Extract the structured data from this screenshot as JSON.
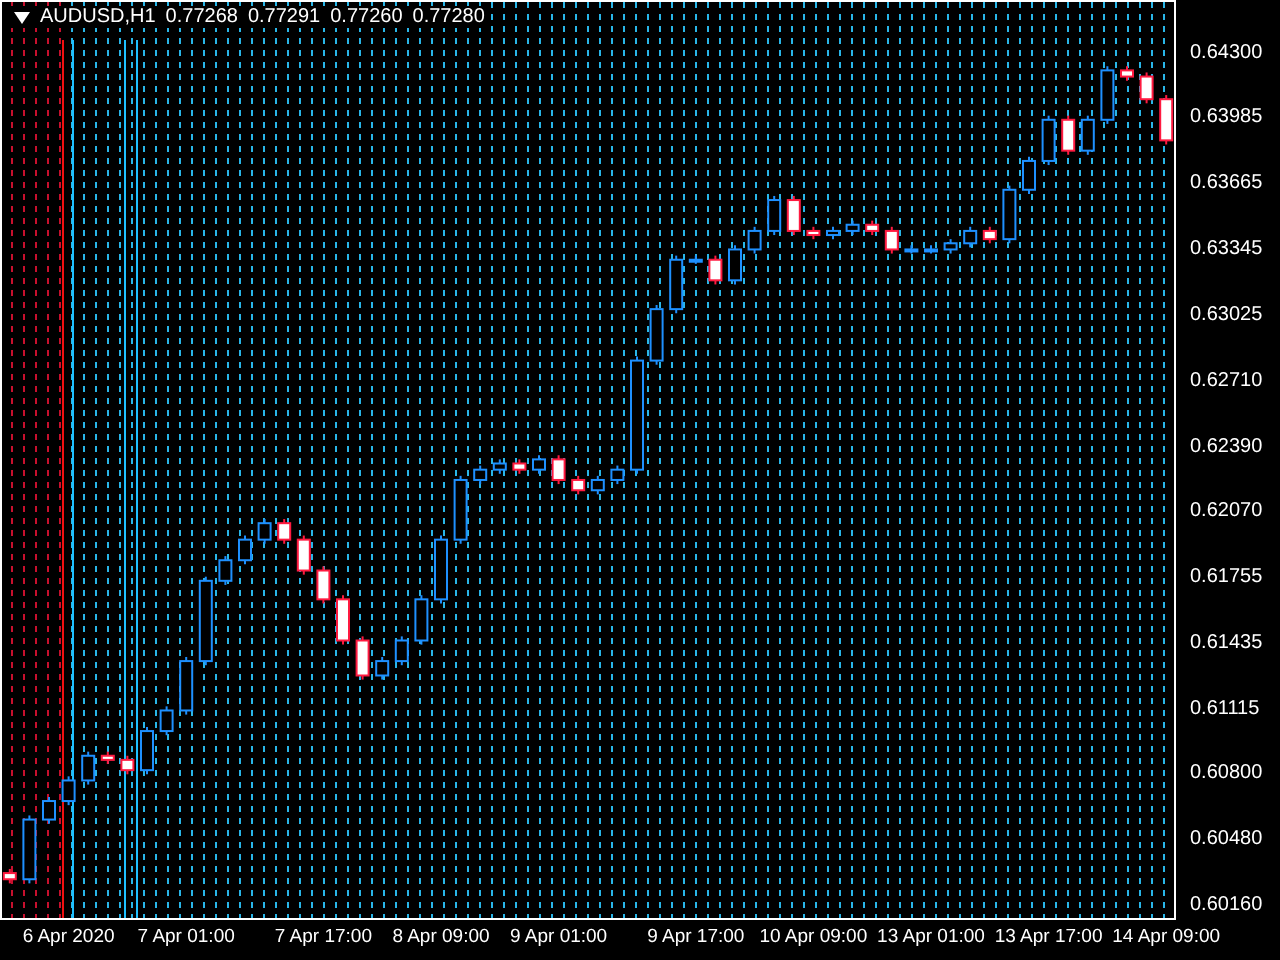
{
  "header": {
    "symbol": "AUDUSD,H1",
    "quotes": [
      "0.77268",
      "0.77291",
      "0.77260",
      "0.77280"
    ]
  },
  "chart_data": {
    "type": "candlestick",
    "ylim": [
      0.60092,
      0.64562
    ],
    "grid": true,
    "categories": [
      null,
      null,
      null,
      "6 Apr 2020",
      null,
      null,
      null,
      null,
      null,
      "7 Apr 01:00",
      null,
      null,
      null,
      null,
      null,
      null,
      "7 Apr 17:00",
      null,
      null,
      null,
      null,
      null,
      "8 Apr 09:00",
      null,
      null,
      null,
      null,
      null,
      "9 Apr 01:00",
      null,
      null,
      null,
      null,
      null,
      null,
      "9 Apr 17:00",
      null,
      null,
      null,
      null,
      null,
      "10 Apr 09:00",
      null,
      null,
      null,
      null,
      null,
      "13 Apr 01:00",
      null,
      null,
      null,
      null,
      null,
      "13 Apr 17:00",
      null,
      null,
      null,
      null,
      null,
      "14 Apr 09:00"
    ],
    "yticks": [
      {
        "value": 0.643,
        "label": "0.64300"
      },
      {
        "value": 0.63985,
        "label": "0.63985"
      },
      {
        "value": 0.63665,
        "label": "0.63665"
      },
      {
        "value": 0.63345,
        "label": "0.63345"
      },
      {
        "value": 0.63025,
        "label": "0.63025"
      },
      {
        "value": 0.6271,
        "label": "0.62710"
      },
      {
        "value": 0.6239,
        "label": "0.62390"
      },
      {
        "value": 0.6207,
        "label": "0.62070"
      },
      {
        "value": 0.61755,
        "label": "0.61755"
      },
      {
        "value": 0.61435,
        "label": "0.61435"
      },
      {
        "value": 0.61115,
        "label": "0.61115"
      },
      {
        "value": 0.608,
        "label": "0.60800"
      },
      {
        "value": 0.6048,
        "label": "0.60480"
      },
      {
        "value": 0.6016,
        "label": "0.60160"
      }
    ],
    "ohlc": [
      [
        0.6032,
        0.6034,
        0.6027,
        0.6029
      ],
      [
        0.6029,
        0.606,
        0.6027,
        0.6058
      ],
      [
        0.6058,
        0.6069,
        0.6056,
        0.6067
      ],
      [
        0.6067,
        0.6079,
        0.6065,
        0.6077
      ],
      [
        0.6077,
        0.6091,
        0.6075,
        0.6089
      ],
      [
        0.6089,
        0.6091,
        0.6085,
        0.6087
      ],
      [
        0.6087,
        0.6089,
        0.608,
        0.6082
      ],
      [
        0.6082,
        0.6103,
        0.608,
        0.6101
      ],
      [
        0.6101,
        0.6113,
        0.6099,
        0.6111
      ],
      [
        0.6111,
        0.6137,
        0.6109,
        0.6135
      ],
      [
        0.6135,
        0.6176,
        0.6133,
        0.6174
      ],
      [
        0.6174,
        0.6186,
        0.6172,
        0.6184
      ],
      [
        0.6184,
        0.6196,
        0.6182,
        0.6194
      ],
      [
        0.6194,
        0.6204,
        0.6192,
        0.6202
      ],
      [
        0.6202,
        0.6204,
        0.6192,
        0.6194
      ],
      [
        0.6194,
        0.6196,
        0.6177,
        0.6179
      ],
      [
        0.6179,
        0.6181,
        0.6163,
        0.6165
      ],
      [
        0.6165,
        0.6167,
        0.6143,
        0.6145
      ],
      [
        0.6145,
        0.6147,
        0.6126,
        0.6128
      ],
      [
        0.6128,
        0.6137,
        0.6126,
        0.6135
      ],
      [
        0.6135,
        0.6147,
        0.6133,
        0.6145
      ],
      [
        0.6145,
        0.6167,
        0.6143,
        0.6165
      ],
      [
        0.6165,
        0.6196,
        0.6163,
        0.6194
      ],
      [
        0.6194,
        0.6225,
        0.6192,
        0.6223
      ],
      [
        0.6223,
        0.623,
        0.6221,
        0.6228
      ],
      [
        0.6228,
        0.6233,
        0.6226,
        0.6231
      ],
      [
        0.6231,
        0.6233,
        0.6226,
        0.6228
      ],
      [
        0.6228,
        0.6235,
        0.6226,
        0.6233
      ],
      [
        0.6233,
        0.6235,
        0.6221,
        0.6223
      ],
      [
        0.6223,
        0.6225,
        0.6216,
        0.6218
      ],
      [
        0.6218,
        0.6225,
        0.6216,
        0.6223
      ],
      [
        0.6223,
        0.623,
        0.6221,
        0.6228
      ],
      [
        0.6228,
        0.6283,
        0.6226,
        0.6281
      ],
      [
        0.6281,
        0.6308,
        0.6279,
        0.6306
      ],
      [
        0.6306,
        0.6332,
        0.6304,
        0.633
      ],
      [
        0.633,
        0.6332,
        0.6328,
        0.633
      ],
      [
        0.633,
        0.6332,
        0.6318,
        0.632
      ],
      [
        0.632,
        0.6337,
        0.6318,
        0.6335
      ],
      [
        0.6335,
        0.6346,
        0.6333,
        0.6344
      ],
      [
        0.6344,
        0.6361,
        0.6342,
        0.6359
      ],
      [
        0.6359,
        0.6361,
        0.6342,
        0.6344
      ],
      [
        0.6344,
        0.6346,
        0.634,
        0.6342
      ],
      [
        0.6342,
        0.6346,
        0.634,
        0.6344
      ],
      [
        0.6344,
        0.6349,
        0.6342,
        0.6347
      ],
      [
        0.6347,
        0.6349,
        0.6342,
        0.6344
      ],
      [
        0.6344,
        0.6346,
        0.6333,
        0.6335
      ],
      [
        0.6335,
        0.6337,
        0.6333,
        0.6335
      ],
      [
        0.6335,
        0.6337,
        0.6333,
        0.6335
      ],
      [
        0.6335,
        0.634,
        0.6333,
        0.6338
      ],
      [
        0.6338,
        0.6346,
        0.6336,
        0.6344
      ],
      [
        0.6344,
        0.6346,
        0.6338,
        0.634
      ],
      [
        0.634,
        0.6366,
        0.6338,
        0.6364
      ],
      [
        0.6364,
        0.638,
        0.6362,
        0.6378
      ],
      [
        0.6378,
        0.64,
        0.6376,
        0.6398
      ],
      [
        0.6398,
        0.64,
        0.6381,
        0.6383
      ],
      [
        0.6383,
        0.64,
        0.6381,
        0.6398
      ],
      [
        0.6398,
        0.6424,
        0.6396,
        0.6422
      ],
      [
        0.6422,
        0.6424,
        0.6417,
        0.6419
      ],
      [
        0.6419,
        0.6421,
        0.6406,
        0.6408
      ],
      [
        0.6408,
        0.641,
        0.6386,
        0.6388
      ]
    ]
  }
}
